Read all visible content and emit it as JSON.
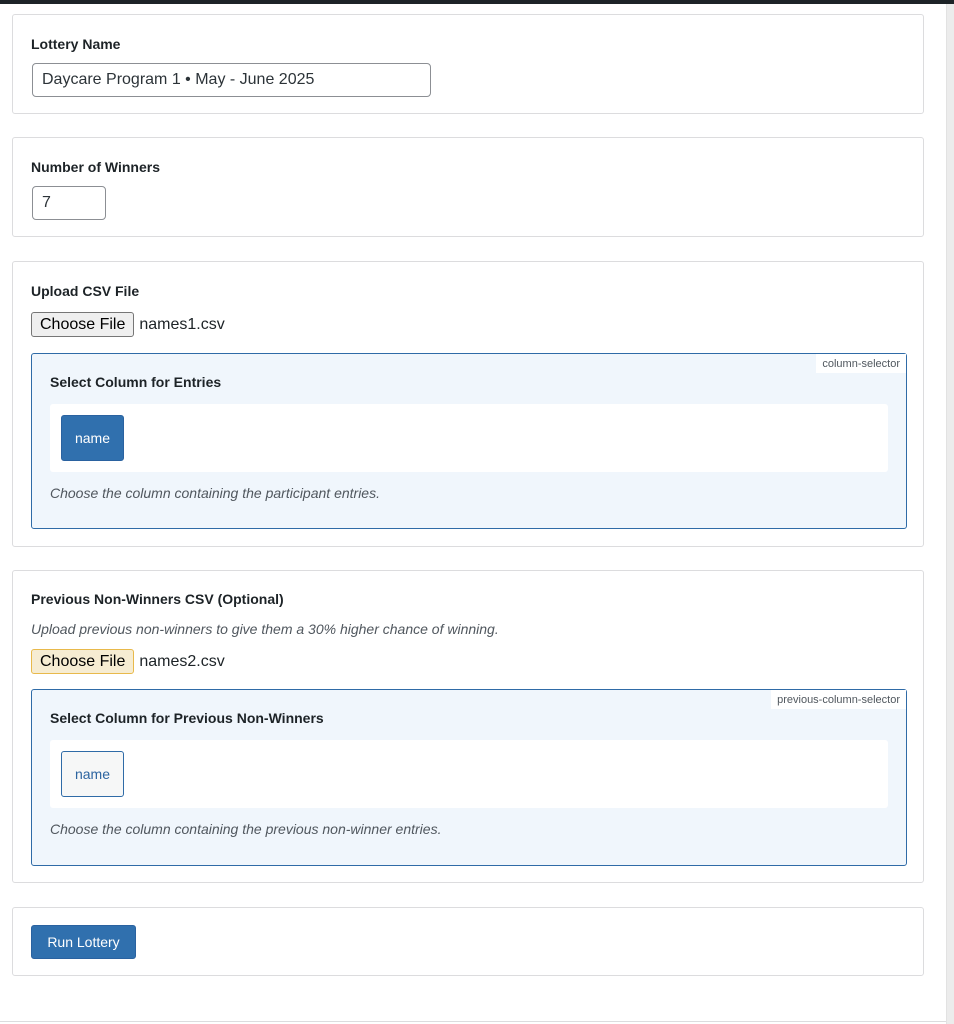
{
  "lottery_name": {
    "label": "Lottery Name",
    "value": "Daycare Program 1  • May - June 2025"
  },
  "winners": {
    "label": "Number of Winners",
    "value": "7"
  },
  "upload_csv": {
    "label": "Upload CSV File",
    "button_label": "Choose File",
    "file_name": "names1.csv",
    "selector": {
      "tag": "column-selector",
      "title": "Select Column for Entries",
      "options": [
        {
          "label": "name",
          "selected": true
        }
      ],
      "hint": "Choose the column containing the participant entries."
    }
  },
  "previous_csv": {
    "label": "Previous Non-Winners CSV (Optional)",
    "description": "Upload previous non-winners to give them a 30% higher chance of winning.",
    "button_label": "Choose File",
    "file_name": "names2.csv",
    "selector": {
      "tag": "previous-column-selector",
      "title": "Select Column for Previous Non-Winners",
      "options": [
        {
          "label": "name",
          "selected": false
        }
      ],
      "hint": "Choose the column containing the previous non-winner entries."
    }
  },
  "actions": {
    "run_label": "Run Lottery"
  },
  "colors": {
    "primary": "#3070ae",
    "selector_bg": "#f0f6fc",
    "selector_border": "#2f6ba7",
    "focus_highlight": "#f6ecd2"
  }
}
